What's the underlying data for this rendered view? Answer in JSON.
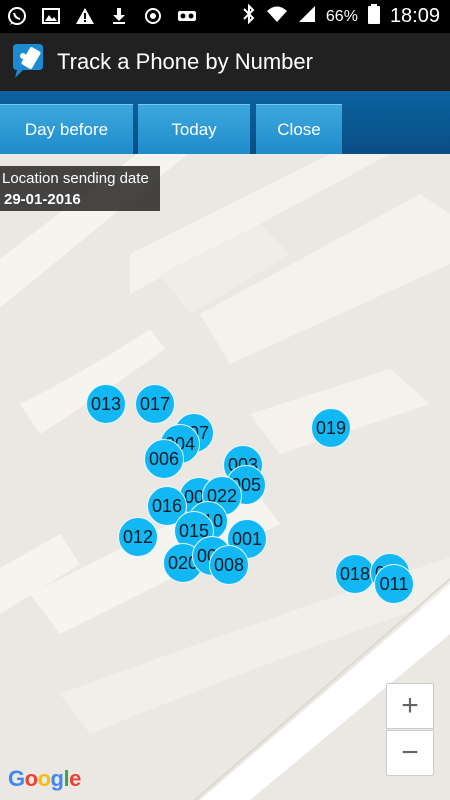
{
  "status_bar": {
    "battery": "66%",
    "time": "18:09",
    "icons": [
      "whatsapp-icon",
      "gallery-icon",
      "warning-icon",
      "download-icon",
      "sync-icon",
      "voicemail-icon",
      "bluetooth-icon",
      "wifi-icon",
      "signal-icon",
      "battery-icon"
    ]
  },
  "app_bar": {
    "title": "Track a Phone by Number",
    "icon": "phone-tracker-app-icon"
  },
  "tabs": [
    {
      "label": "Day before"
    },
    {
      "label": "Today"
    },
    {
      "label": "Close"
    }
  ],
  "info_box": {
    "label": "Location sending date",
    "date": "29-01-2016"
  },
  "markers": [
    "013",
    "017",
    "007",
    "004",
    "006",
    "019",
    "003",
    "005",
    "001",
    "002",
    "022",
    "016",
    "010",
    "015",
    "012",
    "020",
    "009",
    "008",
    "018",
    "011"
  ],
  "zoom": {
    "in": "+",
    "out": "−"
  },
  "attribution": "Google",
  "colors": {
    "marker": "#12b8f3",
    "tab": "#2196d3",
    "app_bar": "#212121"
  }
}
